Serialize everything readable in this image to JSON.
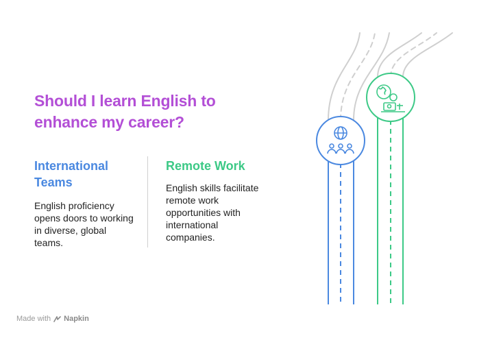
{
  "title": "Should I learn English to enhance my career?",
  "options": [
    {
      "heading": "International Teams",
      "text": "English proficiency opens doors to working in diverse, global teams.",
      "color": "#4a88e0",
      "icon": "globe-people-icon"
    },
    {
      "heading": "Remote Work",
      "text": "English skills facilitate remote work opportunities with international companies.",
      "color": "#3cc986",
      "icon": "globe-laptop-icon"
    }
  ],
  "footer": {
    "made_with": "Made with",
    "brand": "Napkin",
    "icon": "napkin-logo-icon"
  },
  "colors": {
    "title": "#b34fd6",
    "road_gray": "#cfcfcf"
  }
}
